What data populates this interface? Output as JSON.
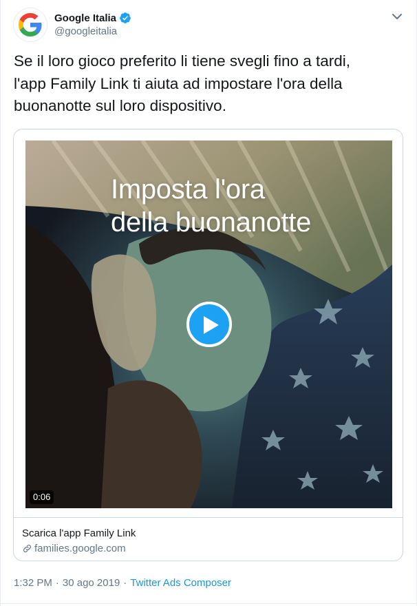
{
  "author": {
    "display_name": "Google Italia",
    "handle": "@googleitalia",
    "avatar_icon": "google-g-logo",
    "verified": true,
    "verified_color": "#1da1f2"
  },
  "tweet": {
    "text": "Se il loro gioco preferito li tiene svegli fino a tardi,\nl'app Family Link ti aiuta ad impostare l'ora della\nbuonanotte sul loro dispositivo."
  },
  "card": {
    "video": {
      "overlay_line1": "Imposta l'ora",
      "overlay_line2": "della buonanotte",
      "duration": "0:06",
      "play_icon": "play-icon"
    },
    "title": "Scarica l'app Family Link",
    "link_text": "families.google.com",
    "link_icon": "link-icon"
  },
  "meta": {
    "time": "1:32 PM",
    "separator": "·",
    "date": "30 ago 2019",
    "separator2": "·",
    "source": "Twitter Ads Composer"
  },
  "colors": {
    "accent": "#1da1f2",
    "link": "#1b95e0",
    "secondary_text": "#657786",
    "border": "#ccd6dd"
  }
}
